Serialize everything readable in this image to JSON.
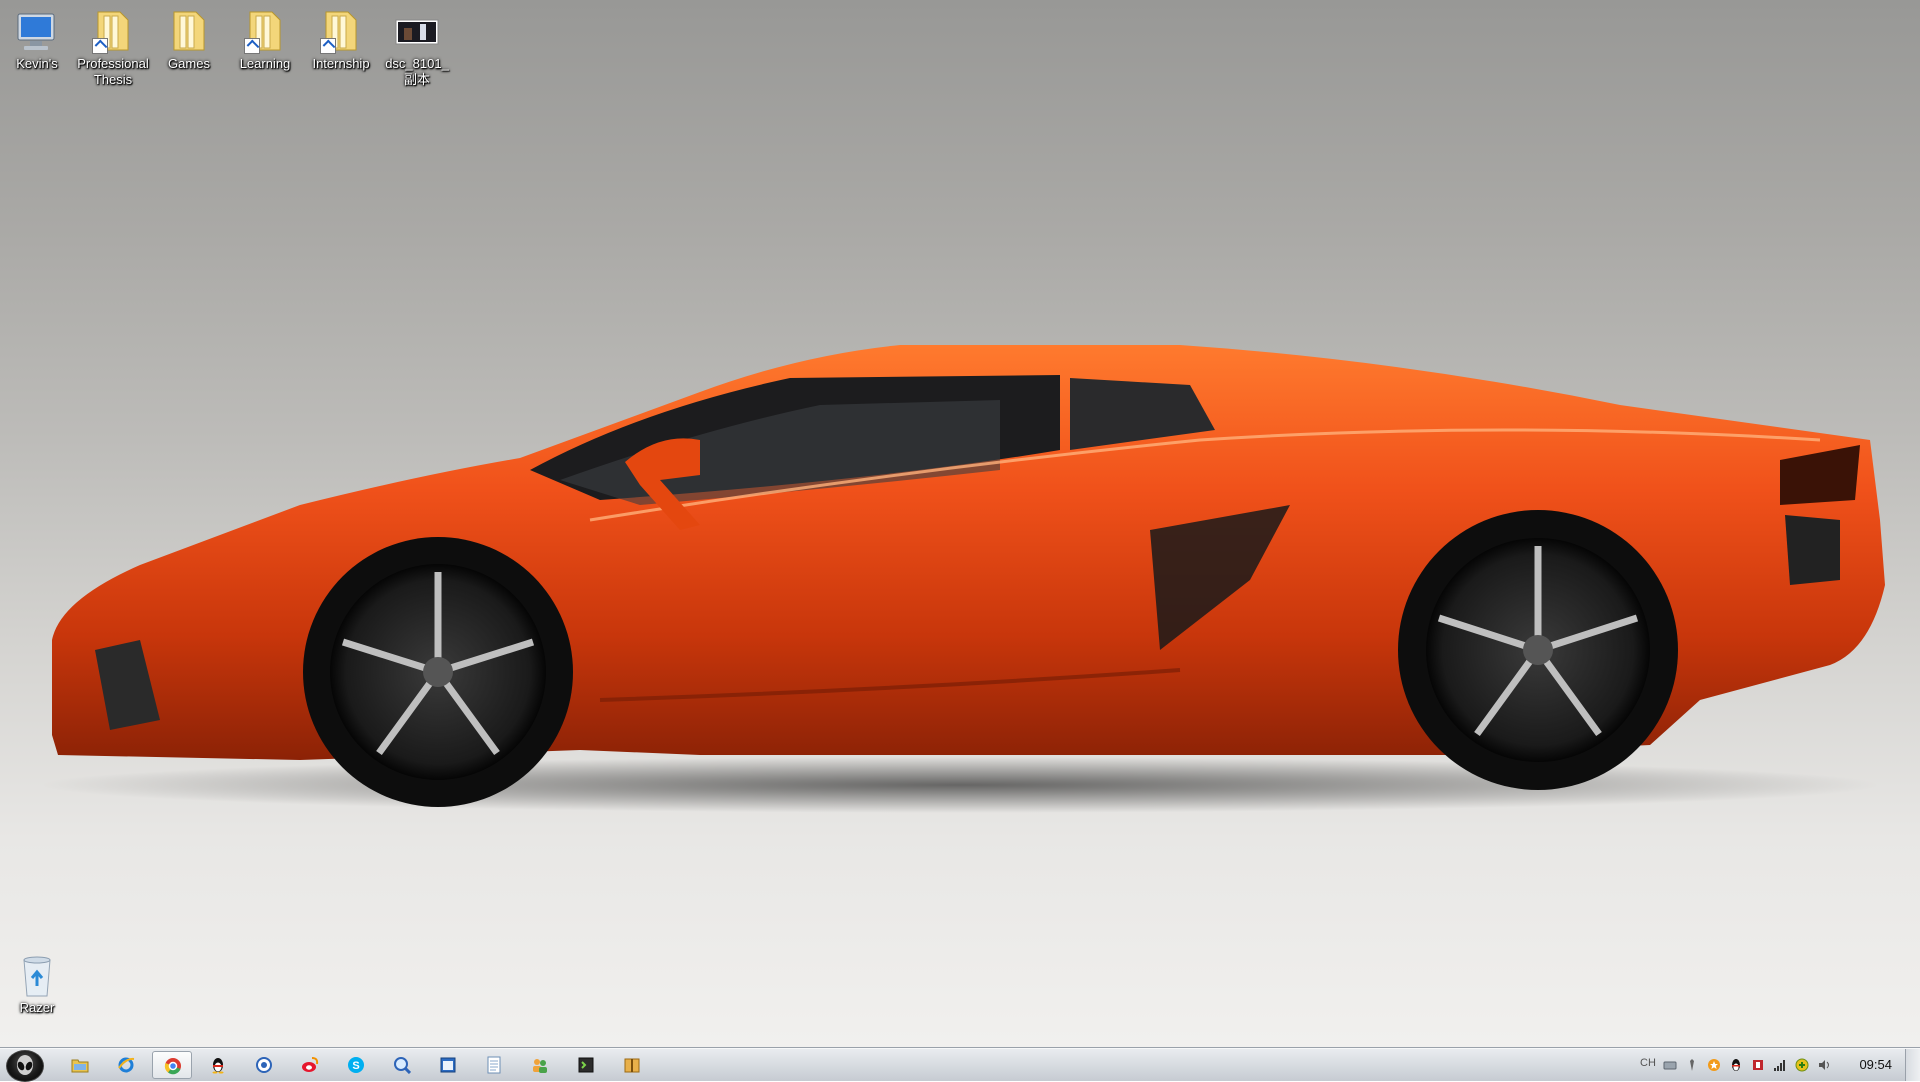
{
  "desktop": {
    "icons_top": [
      {
        "label": "Kevin's",
        "icon": "computer-icon",
        "shortcut": false
      },
      {
        "label": "Professional Thesis",
        "icon": "folder-icon",
        "shortcut": true
      },
      {
        "label": "Games",
        "icon": "folder-icon",
        "shortcut": false
      },
      {
        "label": "Learning",
        "icon": "folder-icon",
        "shortcut": true
      },
      {
        "label": "Internship",
        "icon": "folder-icon",
        "shortcut": true
      },
      {
        "label": "dsc_8101_副本",
        "icon": "image-file-icon",
        "shortcut": false
      }
    ],
    "recycle_bin": {
      "label": "Razer",
      "icon": "recycle-bin-icon"
    }
  },
  "taskbar": {
    "start_button": {
      "icon": "alienware-logo-icon"
    },
    "pinned": [
      {
        "name": "file-explorer",
        "icon": "folder-icon",
        "active": false
      },
      {
        "name": "internet-explorer",
        "icon": "ie-icon",
        "active": false
      },
      {
        "name": "chrome",
        "icon": "chrome-icon",
        "active": true
      },
      {
        "name": "qq",
        "icon": "penguin-icon",
        "active": false
      },
      {
        "name": "app-5",
        "icon": "circle-app-icon",
        "active": false
      },
      {
        "name": "weibo",
        "icon": "weibo-icon",
        "active": false
      },
      {
        "name": "skype",
        "icon": "skype-icon",
        "active": false
      },
      {
        "name": "app-8",
        "icon": "globe-search-icon",
        "active": false
      },
      {
        "name": "app-9",
        "icon": "window-app-icon",
        "active": false
      },
      {
        "name": "notepad",
        "icon": "document-icon",
        "active": false
      },
      {
        "name": "app-11",
        "icon": "people-icon",
        "active": false
      },
      {
        "name": "app-12",
        "icon": "terminal-icon",
        "active": false
      },
      {
        "name": "app-13",
        "icon": "archive-icon",
        "active": false
      }
    ],
    "tray": {
      "language": "CH",
      "icons": [
        "keyboard-icon",
        "pen-icon",
        "star-icon",
        "qq-tray-icon",
        "security-icon",
        "signal-icon",
        "update-icon",
        "volume-icon"
      ],
      "time": "09:54"
    }
  },
  "colors": {
    "car_body": "#e8400c",
    "taskbar": "#d9dde2"
  }
}
